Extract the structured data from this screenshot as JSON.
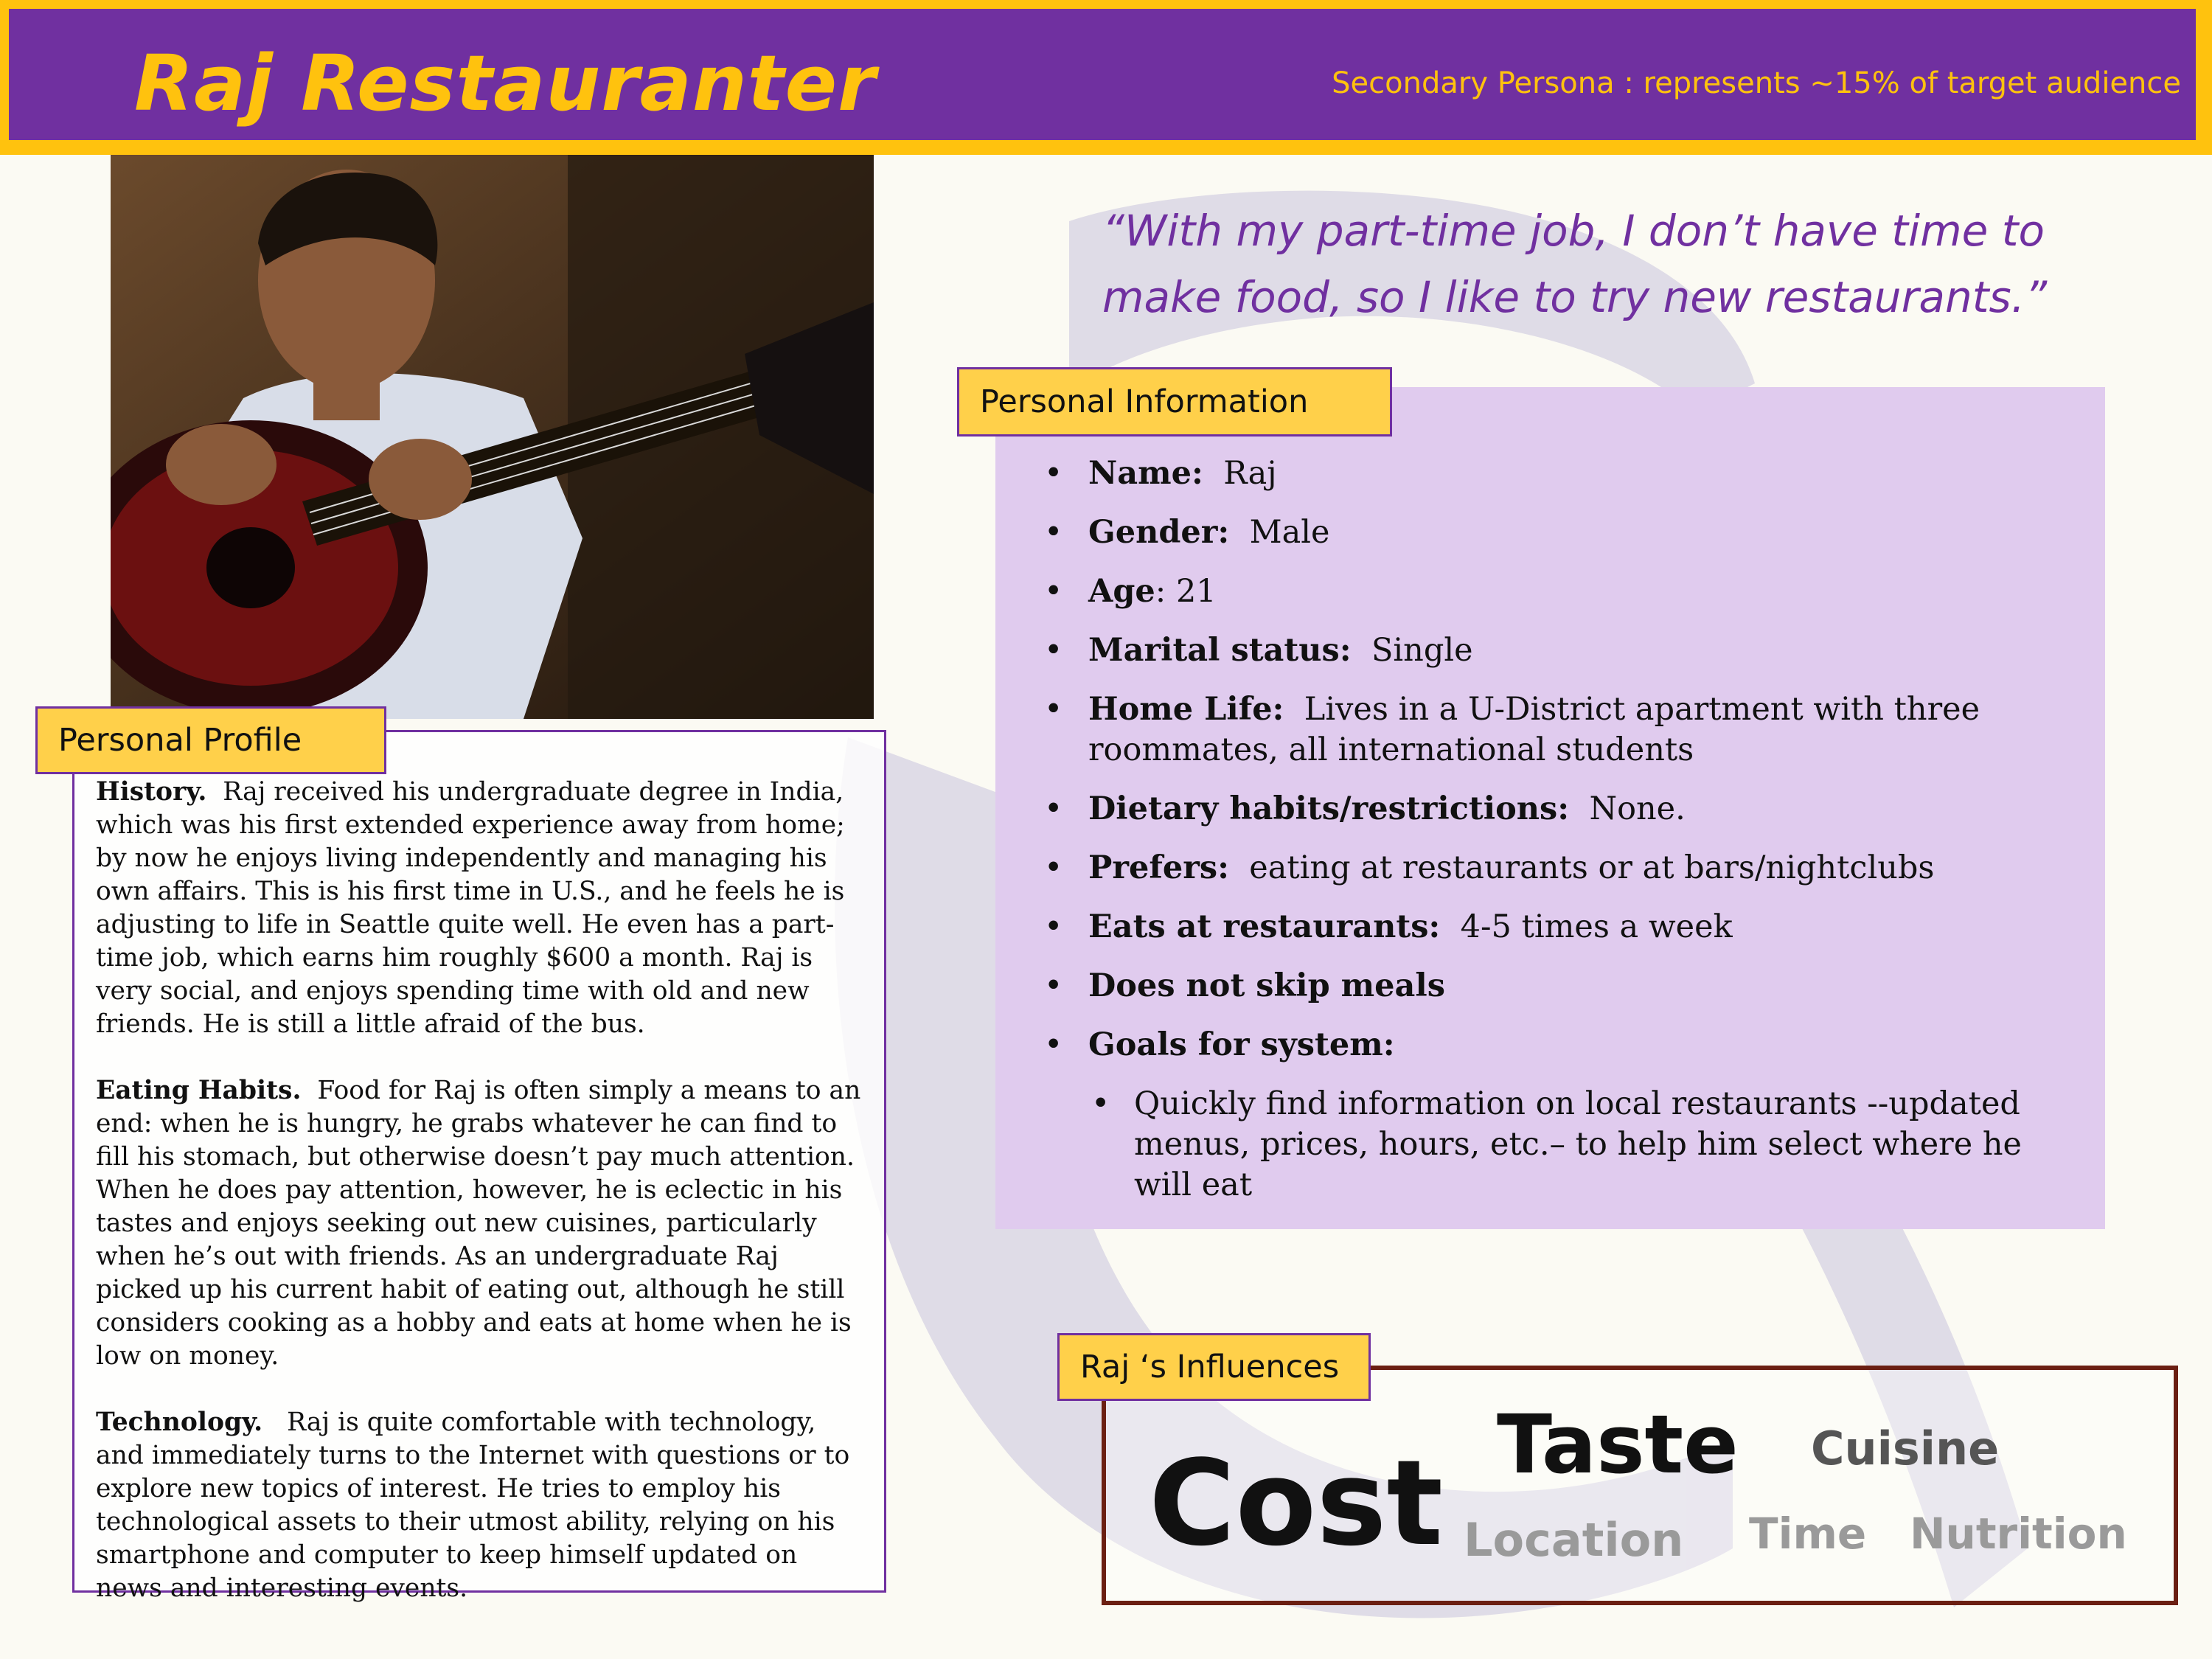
{
  "header": {
    "title": "Raj Restauranter",
    "subtitle": "Secondary Persona : represents ~15% of target audience"
  },
  "colors": {
    "purple": "#7030a0",
    "gold": "#ffc20e",
    "tab_yellow": "#ffd04a",
    "lavender": "#e0cbee",
    "influence_border": "#6b1f12"
  },
  "quote": "“With my part-time job, I don’t have time to make food, so I like to try new restaurants.”",
  "profile": {
    "tab_label": "Personal Profile",
    "sections": [
      {
        "heading": "History.",
        "text": "Raj received his undergraduate degree in India, which was his first extended experience away from home; by now he enjoys living independently and managing his own affairs.  This is his first time in U.S., and he feels he is adjusting to life in Seattle quite well.  He even has a part-time job, which earns him roughly $600 a month.  Raj is very social, and enjoys spending time with old and new friends.  He is still a little afraid of the bus."
      },
      {
        "heading": "Eating Habits.",
        "text": "Food for Raj is often simply a means to an end: when he is hungry, he grabs whatever he can find to fill his stomach, but otherwise doesn’t pay much attention.  When he does pay attention, however,  he is eclectic in his tastes and enjoys seeking out new cuisines, particularly when he’s out with friends.  As an undergraduate Raj picked up his current habit of eating out, although he still considers cooking as a hobby and eats at home when he is low on money."
      },
      {
        "heading": "Technology.",
        "text": "Raj is quite comfortable with technology, and immediately turns to the Internet with questions or to explore new topics of interest.  He tries to employ his technological assets to their utmost ability, relying on his smartphone and computer to keep himself updated on news and interesting events."
      }
    ]
  },
  "info": {
    "tab_label": "Personal Information",
    "items": [
      {
        "label": "Name:",
        "value": "Raj"
      },
      {
        "label": "Gender:",
        "value": "Male"
      },
      {
        "label": "Age",
        "value": ":  21"
      },
      {
        "label": "Marital status:",
        "value": "Single"
      },
      {
        "label": "Home Life:",
        "value": "Lives in a U-District apartment with three roommates, all international students"
      },
      {
        "label": "Dietary habits/restrictions:",
        "value": "None."
      },
      {
        "label": "Prefers:",
        "value": "eating at restaurants or at bars/nightclubs"
      },
      {
        "label": "Eats at restaurants:",
        "value": "4-5 times a week"
      },
      {
        "label": "Does not skip meals",
        "value": ""
      },
      {
        "label": "Goals for system:",
        "value": ""
      }
    ],
    "goals": [
      "Quickly find information on local restaurants  --updated menus, prices, hours, etc.– to help him select where he will eat"
    ]
  },
  "influences": {
    "tab_label": "Raj ‘s Influences",
    "words": [
      {
        "key": "cost",
        "text": "Cost",
        "color": "#111111"
      },
      {
        "key": "taste",
        "text": "Taste",
        "color": "#111111"
      },
      {
        "key": "cuisine",
        "text": "Cuisine",
        "color": "#555555"
      },
      {
        "key": "location",
        "text": "Location",
        "color": "#9a9a9a"
      },
      {
        "key": "time",
        "text": "Time",
        "color": "#9a9a9a"
      },
      {
        "key": "nutrition",
        "text": "Nutrition",
        "color": "#9a9a9a"
      }
    ]
  },
  "photo": {
    "icon": "persona-photo-icon"
  }
}
